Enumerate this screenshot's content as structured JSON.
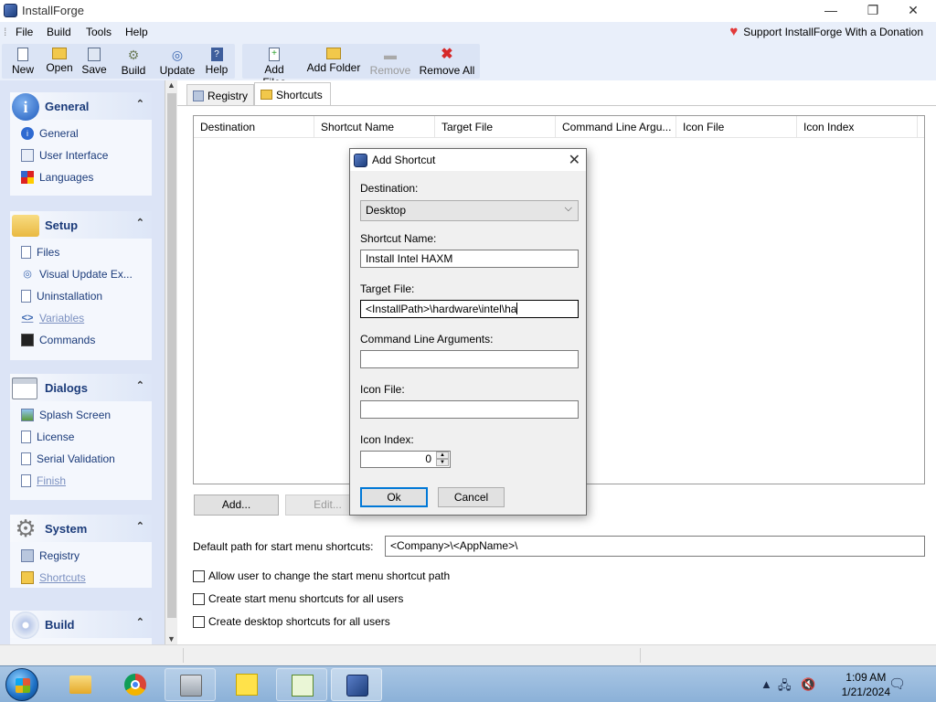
{
  "window": {
    "title": "InstallForge",
    "minimize": "—",
    "restore": "❐",
    "close": "✕"
  },
  "menu": {
    "items": [
      "File",
      "Build",
      "Tools",
      "Help"
    ],
    "donation": "Support InstallForge With a Donation"
  },
  "toolbar": {
    "new": "New",
    "open": "Open",
    "save": "Save",
    "build": "Build",
    "update": "Update",
    "help": "Help",
    "add_files": "Add Files",
    "add_folder": "Add Folder",
    "remove": "Remove",
    "remove_all": "Remove All"
  },
  "sidebar": {
    "general": {
      "title": "General",
      "items": [
        "General",
        "User Interface",
        "Languages"
      ]
    },
    "setup": {
      "title": "Setup",
      "items": [
        "Files",
        "Visual Update Ex...",
        "Uninstallation",
        "Variables",
        "Commands"
      ]
    },
    "dialogs": {
      "title": "Dialogs",
      "items": [
        "Splash Screen",
        "License",
        "Serial Validation",
        "Finish"
      ]
    },
    "system": {
      "title": "System",
      "items": [
        "Registry",
        "Shortcuts"
      ]
    },
    "build": {
      "title": "Build"
    }
  },
  "tabs": {
    "registry": "Registry",
    "shortcuts": "Shortcuts"
  },
  "shortcuts_table": {
    "columns": [
      "Destination",
      "Shortcut Name",
      "Target File",
      "Command Line Argu...",
      "Icon File",
      "Icon Index"
    ],
    "rows": []
  },
  "main": {
    "add_button": "Add...",
    "edit_button": "Edit...",
    "default_path_label": "Default path for start menu shortcuts:",
    "default_path_value": "<Company>\\<AppName>\\",
    "checkbox_allow_change": "Allow user to change the start menu shortcut path",
    "checkbox_startmenu_all": "Create start menu shortcuts for all users",
    "checkbox_desktop_all": "Create desktop shortcuts for all users"
  },
  "dialog": {
    "title": "Add Shortcut",
    "destination_label": "Destination:",
    "destination_value": "Desktop",
    "shortcut_name_label": "Shortcut Name:",
    "shortcut_name_value": "Install Intel HAXM",
    "target_file_label": "Target File:",
    "target_file_value": "<InstallPath>\\hardware\\intel\\ha",
    "cmd_args_label": "Command Line Arguments:",
    "cmd_args_value": "",
    "icon_file_label": "Icon File:",
    "icon_file_value": "",
    "icon_index_label": "Icon Index:",
    "icon_index_value": "0",
    "ok": "Ok",
    "cancel": "Cancel"
  },
  "taskbar": {
    "time": "1:09 AM",
    "date": "1/21/2024"
  },
  "colors": {
    "accent": "#0078d7",
    "sidebar_bg": "#dce4f6",
    "section_title": "#1b3b7a",
    "heart": "#e23a3a"
  }
}
